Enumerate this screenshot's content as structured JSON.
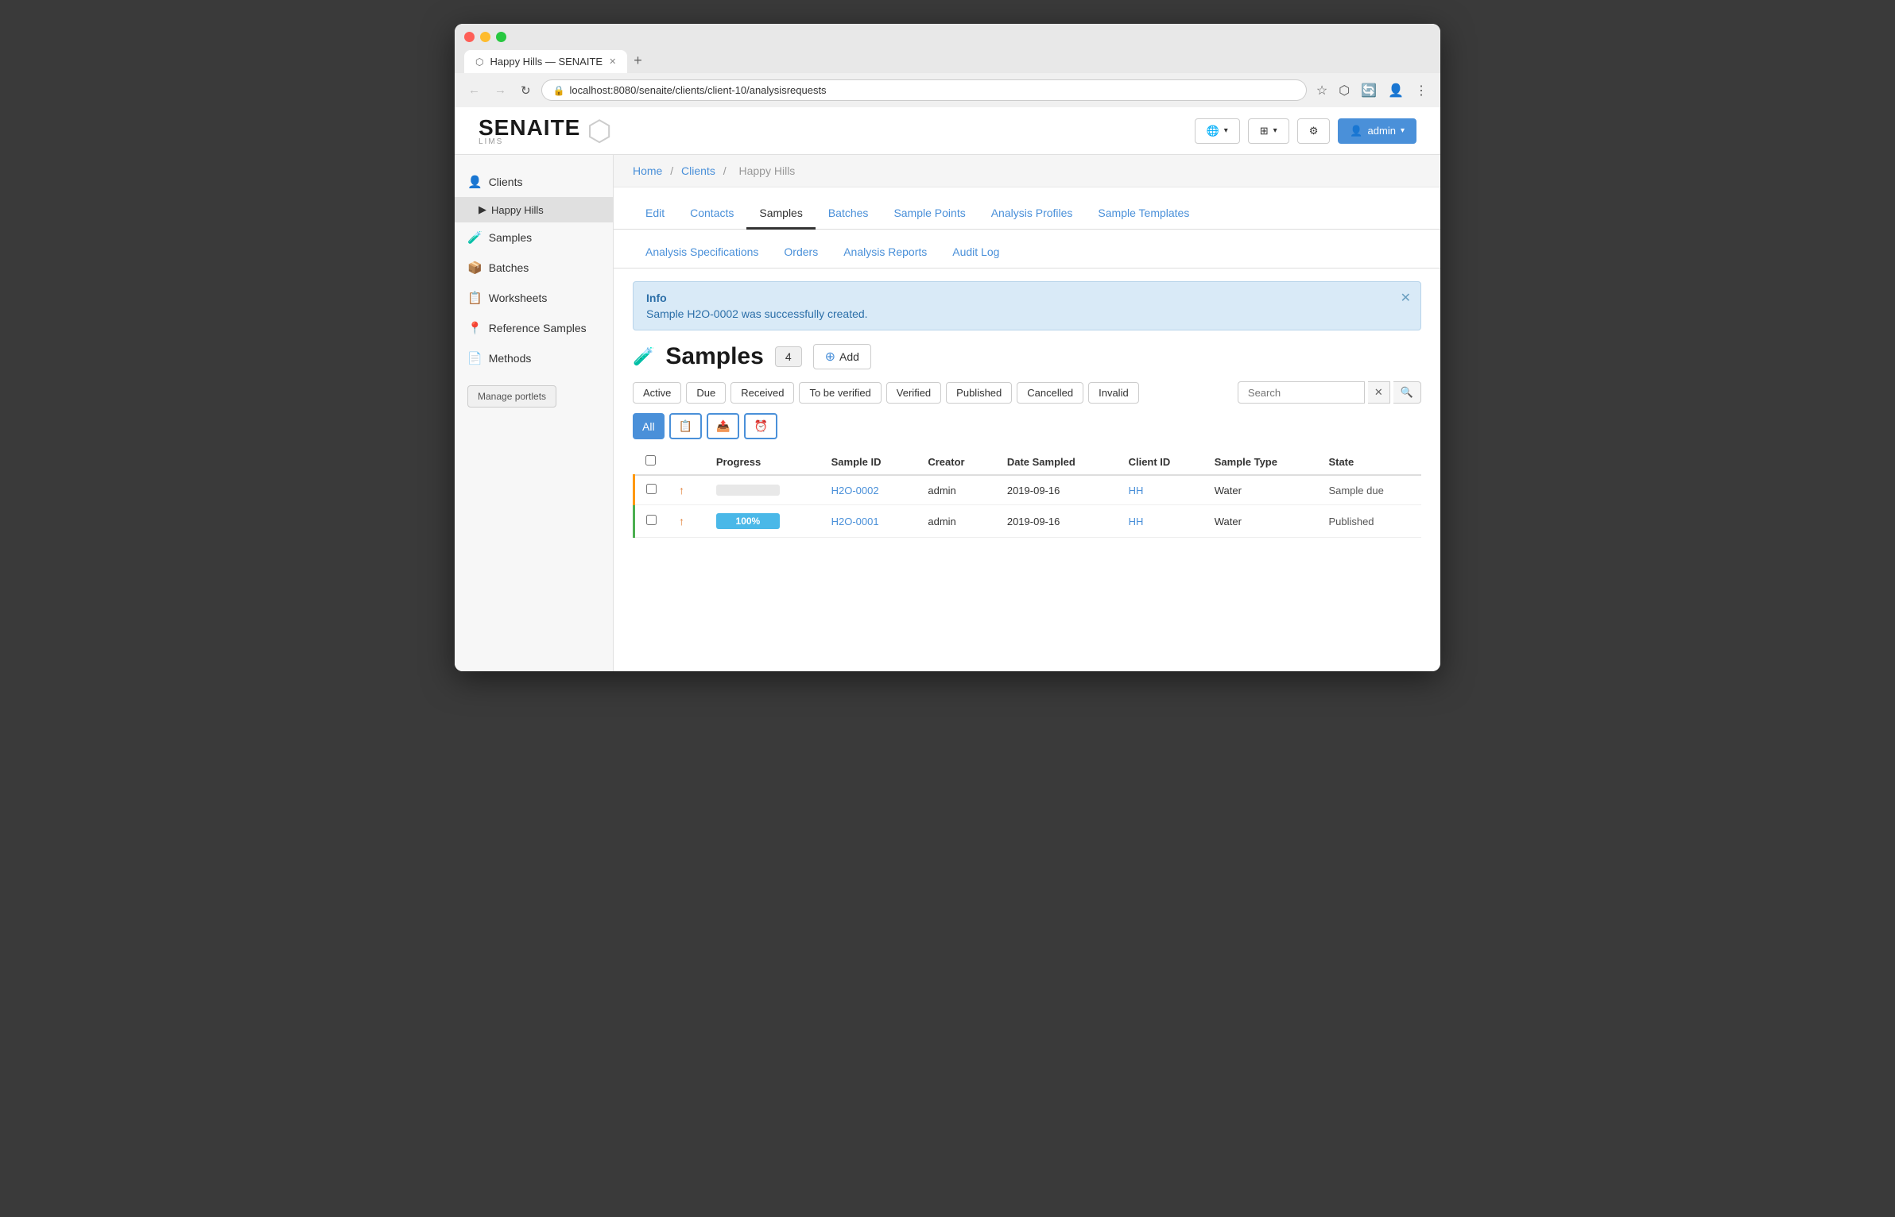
{
  "browser": {
    "tab_title": "Happy Hills — SENAITE",
    "url": "localhost:8080/senaite/clients/client-10/analysisrequests",
    "new_tab_icon": "+"
  },
  "header": {
    "logo_text": "SENAITE",
    "logo_sub": "LIMS",
    "globe_btn": "🌐",
    "grid_btn": "⊞",
    "gear_btn": "⚙",
    "admin_btn": "admin"
  },
  "sidebar": {
    "items": [
      {
        "id": "clients",
        "label": "Clients",
        "icon": "👤"
      },
      {
        "id": "happy-hills",
        "label": "Happy Hills",
        "icon": "▶",
        "child": true
      },
      {
        "id": "samples",
        "label": "Samples",
        "icon": "🧪"
      },
      {
        "id": "batches",
        "label": "Batches",
        "icon": "📦"
      },
      {
        "id": "worksheets",
        "label": "Worksheets",
        "icon": "📋"
      },
      {
        "id": "reference-samples",
        "label": "Reference Samples",
        "icon": "📍"
      },
      {
        "id": "methods",
        "label": "Methods",
        "icon": "📄"
      }
    ],
    "manage_portlets": "Manage portlets"
  },
  "breadcrumb": {
    "home": "Home",
    "clients": "Clients",
    "current": "Happy Hills"
  },
  "tabs": {
    "row1": [
      {
        "id": "edit",
        "label": "Edit",
        "active": false
      },
      {
        "id": "contacts",
        "label": "Contacts",
        "active": false
      },
      {
        "id": "samples",
        "label": "Samples",
        "active": true
      },
      {
        "id": "batches",
        "label": "Batches",
        "active": false
      },
      {
        "id": "sample-points",
        "label": "Sample Points",
        "active": false
      },
      {
        "id": "analysis-profiles",
        "label": "Analysis Profiles",
        "active": false
      },
      {
        "id": "sample-templates",
        "label": "Sample Templates",
        "active": false
      }
    ],
    "row2": [
      {
        "id": "analysis-specifications",
        "label": "Analysis Specifications",
        "active": false
      },
      {
        "id": "orders",
        "label": "Orders",
        "active": false
      },
      {
        "id": "analysis-reports",
        "label": "Analysis Reports",
        "active": false
      },
      {
        "id": "audit-log",
        "label": "Audit Log",
        "active": false
      }
    ]
  },
  "info_box": {
    "title": "Info",
    "message": "Sample H2O-0002 was successfully created."
  },
  "samples_section": {
    "icon": "🧪",
    "title": "Samples",
    "count": "4",
    "add_label": "Add",
    "filters": [
      {
        "id": "active",
        "label": "Active"
      },
      {
        "id": "due",
        "label": "Due"
      },
      {
        "id": "received",
        "label": "Received"
      },
      {
        "id": "to-be-verified",
        "label": "To be verified"
      },
      {
        "id": "verified",
        "label": "Verified"
      },
      {
        "id": "published",
        "label": "Published"
      },
      {
        "id": "cancelled",
        "label": "Cancelled"
      },
      {
        "id": "invalid",
        "label": "Invalid"
      }
    ],
    "search_placeholder": "Search",
    "actions": [
      {
        "id": "all",
        "label": "All",
        "active": true
      },
      {
        "id": "assign",
        "label": "📋",
        "title": "Assign"
      },
      {
        "id": "unassign",
        "label": "📤",
        "title": "Unassign"
      },
      {
        "id": "schedule",
        "label": "⏰",
        "title": "Schedule"
      }
    ],
    "table": {
      "headers": [
        "",
        "",
        "Progress",
        "Sample ID",
        "Creator",
        "Date Sampled",
        "Client ID",
        "Sample Type",
        "State"
      ],
      "rows": [
        {
          "id": "row-h2o-0002",
          "border_color": "orange",
          "checkbox": false,
          "arrow": "↑",
          "progress_pct": 0,
          "progress_label": "",
          "sample_id": "H2O-0002",
          "creator": "admin",
          "date_sampled": "2019-09-16",
          "client_id": "HH",
          "sample_type": "Water",
          "state": "Sample due"
        },
        {
          "id": "row-h2o-0001",
          "border_color": "green",
          "checkbox": false,
          "arrow": "↑",
          "progress_pct": 100,
          "progress_label": "100%",
          "sample_id": "H2O-0001",
          "creator": "admin",
          "date_sampled": "2019-09-16",
          "client_id": "HH",
          "sample_type": "Water",
          "state": "Published"
        }
      ]
    }
  }
}
